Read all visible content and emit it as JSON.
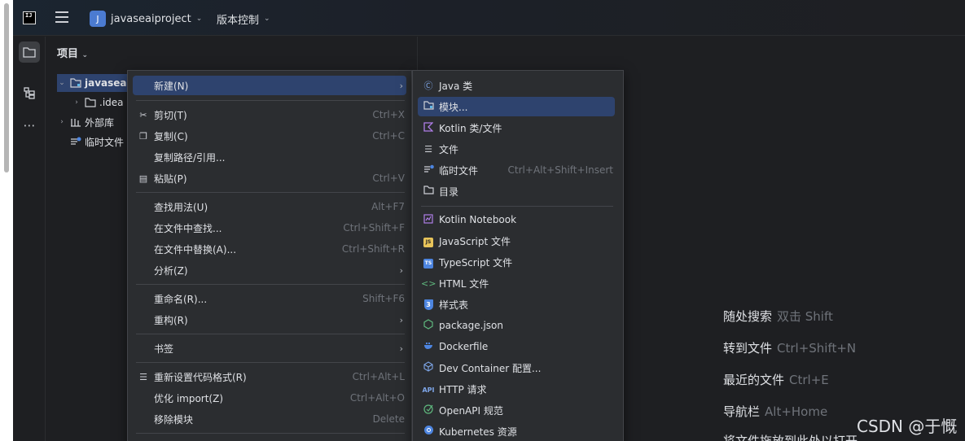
{
  "titlebar": {
    "logo_text": "IJ",
    "project_initial": "J",
    "project_name": "javaseaiproject",
    "vcs_label": "版本控制"
  },
  "project_panel": {
    "title": "项目",
    "tree": [
      {
        "label": "javasea",
        "arrow": "⌄",
        "icon": "module-folder-icon"
      },
      {
        "label": ".idea",
        "arrow": "›",
        "icon": "folder-icon"
      },
      {
        "label": "外部库",
        "arrow": "›",
        "icon": "library-icon"
      },
      {
        "label": "临时文件",
        "arrow": "",
        "icon": "scratch-file-icon"
      }
    ]
  },
  "context_menu": {
    "items": [
      {
        "label": "新建(N)",
        "shortcut": "",
        "submenu": true,
        "icon": ""
      },
      {
        "label": "剪切(T)",
        "shortcut": "Ctrl+X",
        "icon": "scissors-icon"
      },
      {
        "label": "复制(C)",
        "shortcut": "Ctrl+C",
        "icon": "copy-icon"
      },
      {
        "label": "复制路径/引用...",
        "shortcut": "",
        "icon": ""
      },
      {
        "label": "粘贴(P)",
        "shortcut": "Ctrl+V",
        "icon": "paste-icon"
      },
      {
        "label": "查找用法(U)",
        "shortcut": "Alt+F7",
        "icon": ""
      },
      {
        "label": "在文件中查找...",
        "shortcut": "Ctrl+Shift+F",
        "icon": ""
      },
      {
        "label": "在文件中替换(A)...",
        "shortcut": "Ctrl+Shift+R",
        "icon": ""
      },
      {
        "label": "分析(Z)",
        "shortcut": "",
        "submenu": true,
        "icon": ""
      },
      {
        "label": "重命名(R)...",
        "shortcut": "Shift+F6",
        "icon": ""
      },
      {
        "label": "重构(R)",
        "shortcut": "",
        "submenu": true,
        "icon": ""
      },
      {
        "label": "书签",
        "shortcut": "",
        "submenu": true,
        "icon": ""
      },
      {
        "label": "重新设置代码格式(R)",
        "shortcut": "Ctrl+Alt+L",
        "icon": "reformat-icon"
      },
      {
        "label": "优化 import(Z)",
        "shortcut": "Ctrl+Alt+O",
        "icon": ""
      },
      {
        "label": "移除模块",
        "shortcut": "Delete",
        "icon": ""
      }
    ]
  },
  "new_submenu": {
    "items": [
      {
        "label": "Java 类",
        "shortcut": "",
        "icon": "java-class-icon"
      },
      {
        "label": "模块...",
        "shortcut": "",
        "icon": "module-icon"
      },
      {
        "label": "Kotlin 类/文件",
        "shortcut": "",
        "icon": "kotlin-icon"
      },
      {
        "label": "文件",
        "shortcut": "",
        "icon": "file-icon"
      },
      {
        "label": "临时文件",
        "shortcut": "Ctrl+Alt+Shift+Insert",
        "icon": "scratch-file-icon"
      },
      {
        "label": "目录",
        "shortcut": "",
        "icon": "folder-icon"
      },
      {
        "label": "Kotlin Notebook",
        "shortcut": "",
        "icon": "notebook-icon"
      },
      {
        "label": "JavaScript 文件",
        "shortcut": "",
        "icon": "javascript-icon"
      },
      {
        "label": "TypeScript 文件",
        "shortcut": "",
        "icon": "typescript-icon"
      },
      {
        "label": "HTML 文件",
        "shortcut": "",
        "icon": "html-icon"
      },
      {
        "label": "样式表",
        "shortcut": "",
        "icon": "css-icon"
      },
      {
        "label": "package.json",
        "shortcut": "",
        "icon": "nodejs-icon"
      },
      {
        "label": "Dockerfile",
        "shortcut": "",
        "icon": "docker-icon"
      },
      {
        "label": "Dev Container 配置...",
        "shortcut": "",
        "icon": "dev-container-icon"
      },
      {
        "label": "HTTP 请求",
        "shortcut": "",
        "icon": "api-icon"
      },
      {
        "label": "OpenAPI 规范",
        "shortcut": "",
        "icon": "openapi-icon"
      },
      {
        "label": "Kubernetes 资源",
        "shortcut": "",
        "icon": "kubernetes-icon"
      }
    ]
  },
  "hints": [
    {
      "label": "随处搜索",
      "shortcut": "双击 Shift"
    },
    {
      "label": "转到文件",
      "shortcut": "Ctrl+Shift+N"
    },
    {
      "label": "最近的文件",
      "shortcut": "Ctrl+E"
    },
    {
      "label": "导航栏",
      "shortcut": "Alt+Home"
    },
    {
      "label": "将文件拖放到此处以打开",
      "shortcut": ""
    }
  ],
  "watermark": "CSDN @于慨"
}
